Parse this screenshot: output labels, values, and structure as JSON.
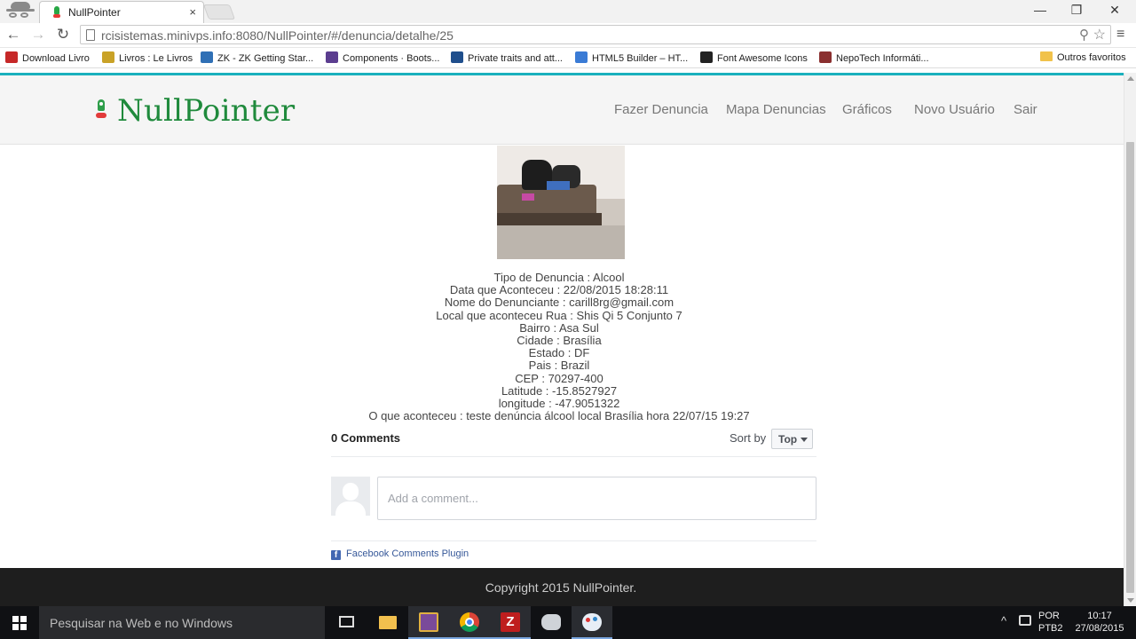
{
  "browser": {
    "tab_title": "NullPointer",
    "tab_close": "×",
    "url": "rcisistemas.minivps.info:8080/NullPointer/#/denuncia/detalhe/25",
    "window_controls": {
      "minimize": "—",
      "restore": "❐",
      "close": "✕"
    },
    "nav": {
      "back": "←",
      "forward": "→",
      "reload": "↻"
    },
    "bookmarks": [
      {
        "label": "Download Livro",
        "icon_color": "#c62828"
      },
      {
        "label": "Livros : Le Livros",
        "icon_color": "#c9a227"
      },
      {
        "label": "ZK - ZK Getting Star...",
        "icon_color": "#2f6fb5"
      },
      {
        "label": "Components · Boots...",
        "icon_color": "#5b3d8f"
      },
      {
        "label": "Private traits and att...",
        "icon_color": "#1f4e8c"
      },
      {
        "label": "HTML5 Builder – HT...",
        "icon_color": "#3a7bd5"
      },
      {
        "label": "Font Awesome Icons",
        "icon_color": "#222222"
      },
      {
        "label": "NepoTech Informáti...",
        "icon_color": "#8a2f2f"
      }
    ],
    "other_bookmarks": "Outros favoritos"
  },
  "site": {
    "brand": "NullPointer",
    "nav_links": [
      "Fazer Denuncia",
      "Mapa Denuncias",
      "Gráficos",
      "Novo Usuário",
      "Sair"
    ],
    "accent_color": "#1ab0bd",
    "brand_color": "#1f8a3c"
  },
  "denuncia": {
    "lines": [
      "Tipo de Denuncia : Alcool",
      "Data que Aconteceu : 22/08/2015 18:28:11",
      "Nome do Denunciante : carill8rg@gmail.com",
      "Local que aconteceu Rua : Shis Qi 5 Conjunto 7",
      "Bairro : Asa Sul",
      "Cidade : Brasília",
      "Estado : DF",
      "Pais : Brazil",
      "CEP : 70297-400",
      "Latitude : -15.8527927",
      "longitude : -47.9051322",
      "O que aconteceu : teste denúncia álcool local Brasília hora 22/07/15 19:27"
    ]
  },
  "comments": {
    "count_label": "0 Comments",
    "sort_label": "Sort by",
    "sort_value": "Top",
    "placeholder": "Add a comment...",
    "plugin_label": "Facebook Comments Plugin",
    "plugin_icon": "f"
  },
  "footer": {
    "text": "Copyright 2015 NullPointer."
  },
  "taskbar": {
    "search_placeholder": "Pesquisar na Web e no Windows",
    "lang_top": "POR",
    "lang_bottom": "PTB2",
    "time": "10:17",
    "date": "27/08/2015"
  }
}
